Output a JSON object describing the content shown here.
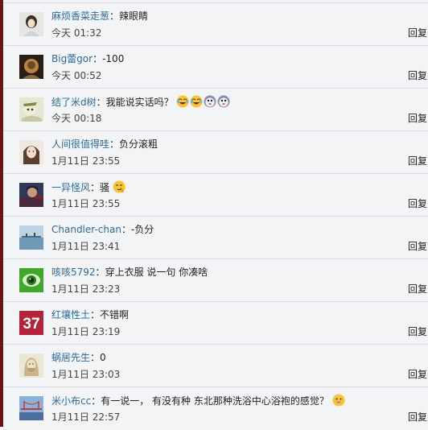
{
  "colors": {
    "accent": "#6a1412",
    "username": "#2b6b9a",
    "background": "#f3f4f6"
  },
  "comments": [
    {
      "user": "麻烦香菜走葱",
      "sep": "：",
      "text": "辣眼睛",
      "time": "今天 01:32",
      "reply": "回复"
    },
    {
      "user": "Big蕾gor",
      "sep": "：",
      "text": "-100",
      "time": "今天 00:52",
      "reply": "回复"
    },
    {
      "user": "结了米d树",
      "sep": "：",
      "text": "我能说实话吗？",
      "emojis": [
        "laugh-cry-emoji",
        "laugh-cry-emoji",
        "doge-emoji",
        "doge-emoji"
      ],
      "time": "今天 00:18",
      "reply": "回复"
    },
    {
      "user": "人间很值得哇",
      "sep": "：",
      "text": "负分滚粗",
      "time": "1月11日 23:55",
      "reply": "回复"
    },
    {
      "user": "一异怪风",
      "sep": "：",
      "text": "骚",
      "emojis": [
        "smirk-emoji"
      ],
      "time": "1月11日 23:55",
      "reply": "回复"
    },
    {
      "user": "Chandler-chan",
      "sep": "：",
      "text": "-负分",
      "time": "1月11日 23:41",
      "reply": "回复"
    },
    {
      "user": "咳咳5792",
      "sep": "：",
      "text": "穿上衣服 说一句 你凑啥",
      "time": "1月11日 23:23",
      "reply": "回复"
    },
    {
      "user": "红壤性土",
      "sep": "：",
      "text": "不错啊",
      "time": "1月11日 23:19",
      "reply": "回复",
      "avatar_text": "37"
    },
    {
      "user": "蜗居先生",
      "sep": "：",
      "text": "0",
      "time": "1月11日 23:03",
      "reply": "回复"
    },
    {
      "user": "米小布cc",
      "sep": "：",
      "text": "有一说一， 有没有种 东北那种洗浴中心浴袍的感觉？",
      "emojis": [
        "pig-emoji"
      ],
      "time": "1月11日 22:57",
      "reply": "回复"
    }
  ]
}
